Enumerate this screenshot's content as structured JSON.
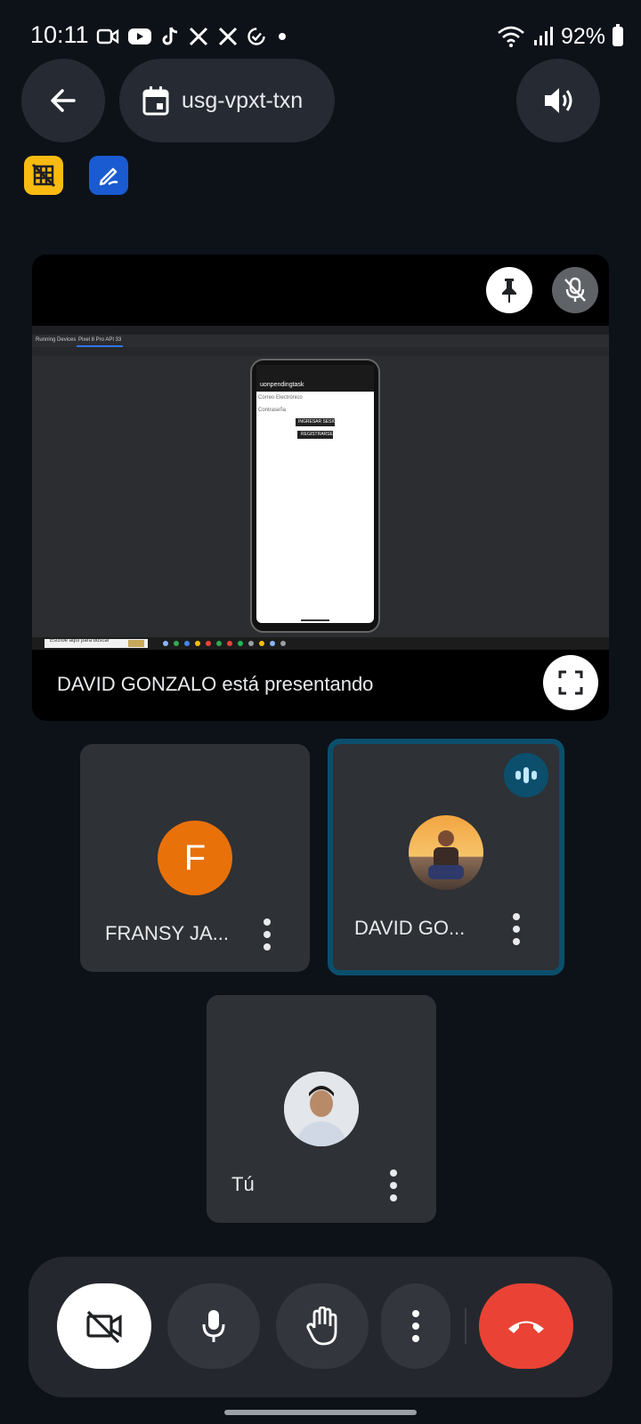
{
  "status_bar": {
    "time": "10:11",
    "battery": "92%",
    "notification_icons": [
      "video-icon",
      "youtube-icon",
      "tiktok-icon",
      "x-icon",
      "x-icon",
      "check-circle-icon",
      "dot-icon"
    ]
  },
  "header": {
    "meeting_code": "usg-vpxt-txn"
  },
  "presentation": {
    "caption": "DAVID GONZALO está presentando",
    "shared_app_title": "uonpendingtask",
    "shared_email_placeholder": "Correo Electrónico",
    "shared_password_placeholder": "Contraseña",
    "shared_login_button": "INGRESAR SESIÓN",
    "shared_register_button": "REGISTRARSE",
    "shared_taskbar_search": "Escribe aquí para buscar",
    "shared_tab_running": "Running Devices",
    "shared_tab_device": "Pixel 8 Pro API 33"
  },
  "participants": [
    {
      "name": "FRANSY JA...",
      "initial": "F",
      "avatar_color": "#e8710a"
    },
    {
      "name": "DAVID GO...",
      "speaking": true
    },
    {
      "name": "Tú"
    }
  ],
  "colors": {
    "speaking_border": "#0b4f6c",
    "end_call": "#ea4335",
    "amber_badge": "#f9bb12",
    "blue_badge": "#1a5bd1"
  }
}
